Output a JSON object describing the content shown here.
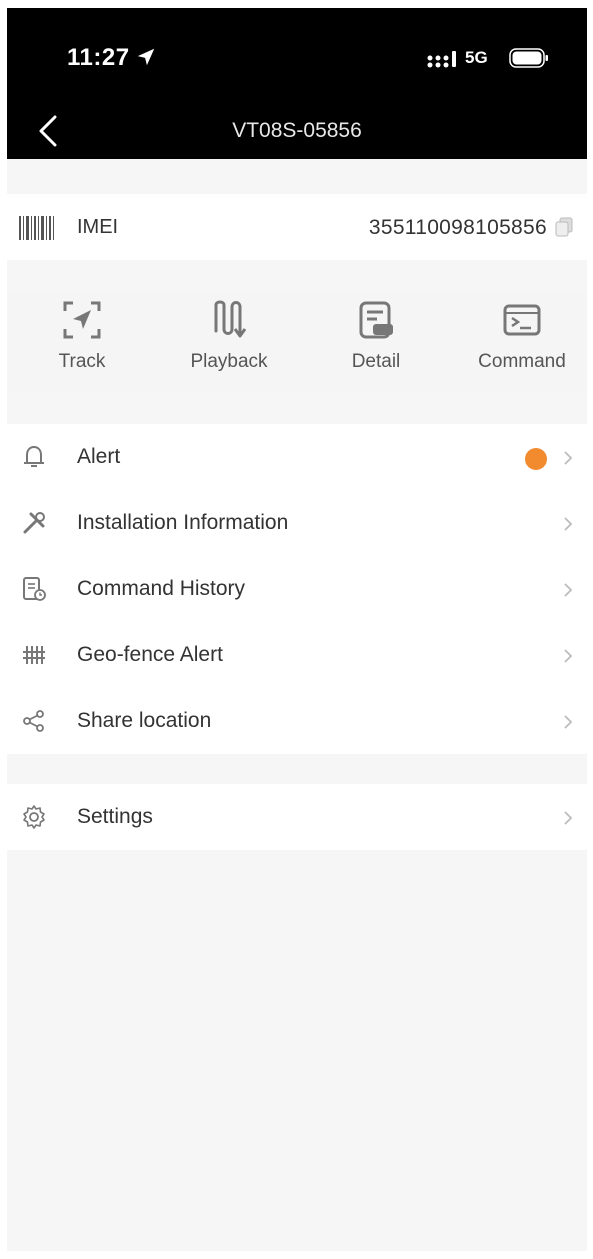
{
  "status": {
    "time": "11:27",
    "network": "5G",
    "icons": [
      "location-arrow-icon",
      "signal-icon",
      "battery-icon"
    ]
  },
  "nav": {
    "title": "VT08S-05856",
    "back_icon": "chevron-left-icon"
  },
  "imei": {
    "label": "IMEI",
    "value": "355110098105856",
    "icons": [
      "barcode-icon",
      "copy-icon"
    ]
  },
  "actions": [
    {
      "label": "Track",
      "icon": "track-icon"
    },
    {
      "label": "Playback",
      "icon": "playback-icon"
    },
    {
      "label": "Detail",
      "icon": "detail-icon"
    },
    {
      "label": "Command",
      "icon": "command-terminal-icon"
    }
  ],
  "menu": [
    {
      "label": "Alert",
      "icon": "bell-icon",
      "badge": true
    },
    {
      "label": "Installation Information",
      "icon": "tools-icon"
    },
    {
      "label": "Command History",
      "icon": "history-doc-icon"
    },
    {
      "label": "Geo-fence Alert",
      "icon": "fence-icon"
    },
    {
      "label": "Share location",
      "icon": "share-icon"
    }
  ],
  "settings": {
    "label": "Settings",
    "icon": "gear-icon"
  },
  "colors": {
    "accent_badge": "#f28a2e",
    "bar_background": "#000000",
    "page_background": "#f6f6f6",
    "icon_gray": "#8a8a8a"
  }
}
